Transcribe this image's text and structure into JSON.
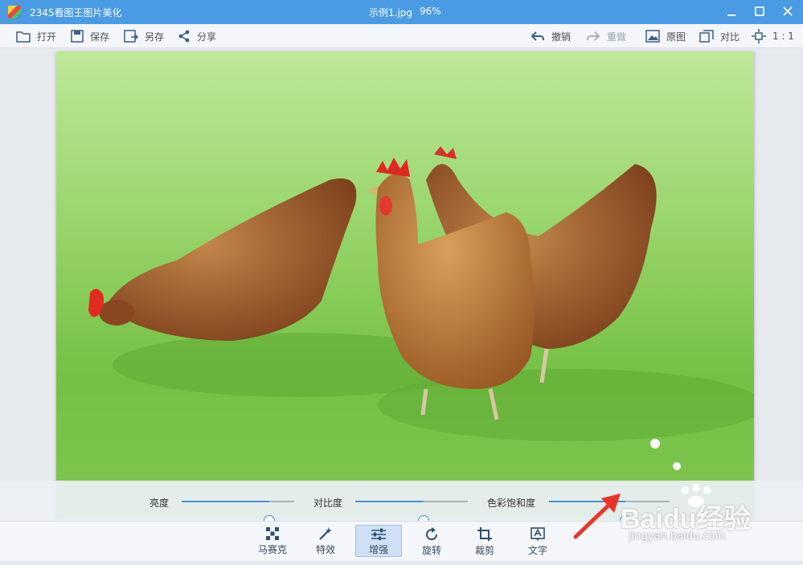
{
  "window": {
    "app_title": "2345看图王图片美化",
    "file_name": "示例1.jpg",
    "zoom": "96%"
  },
  "toolbar": {
    "open_label": "打开",
    "save_label": "保存",
    "save_as_label": "另存",
    "share_label": "分享",
    "undo_label": "撤销",
    "redo_label": "重做",
    "original_label": "原图",
    "compare_label": "对比",
    "actual_size_label": "1 : 1"
  },
  "adjust": {
    "brightness_label": "亮度",
    "brightness_value": 0.78,
    "contrast_label": "对比度",
    "contrast_value": 0.61,
    "saturation_label": "色彩饱和度",
    "saturation_value": 0.63
  },
  "bottom_tools": [
    {
      "label": "马赛克",
      "icon": "mosaic-icon"
    },
    {
      "label": "特效",
      "icon": "magic-wand-icon"
    },
    {
      "label": "增强",
      "icon": "sliders-icon",
      "active": true
    },
    {
      "label": "旋转",
      "icon": "rotate-icon"
    },
    {
      "label": "裁剪",
      "icon": "crop-icon"
    },
    {
      "label": "文字",
      "icon": "text-icon"
    }
  ],
  "watermark": {
    "text": "Baidu经验",
    "sub": "jingyan.baidu.com"
  },
  "colors": {
    "titlebar": "#4a9be3",
    "accent": "#4a90d9",
    "arrow": "#e8352c"
  }
}
